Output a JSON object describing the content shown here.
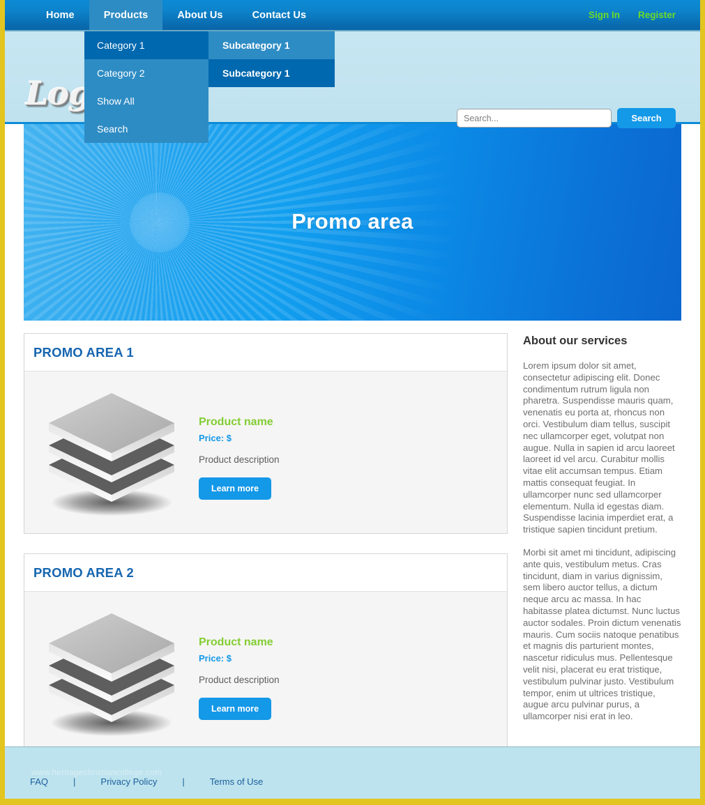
{
  "colors": {
    "page_border": "#e3c520",
    "nav_blue": "#0d84cc",
    "nav_active": "#2e8cc4",
    "dropdown_bg": "#2e8cc4",
    "dropdown_highlight": "#0068ae",
    "header_bg": "#c6e6f2",
    "auth_green": "#6ddb2a",
    "accent_blue": "#1498e8",
    "product_name_green": "#83cd34",
    "card_title_blue": "#1565b0",
    "footer_bg": "#bde3ee",
    "footer_link": "#1b5f9c"
  },
  "nav": {
    "items": [
      {
        "label": "Home",
        "active": false
      },
      {
        "label": "Products",
        "active": true
      },
      {
        "label": "About Us",
        "active": false
      },
      {
        "label": "Contact Us",
        "active": false
      }
    ],
    "sign_in": "Sign In",
    "register": "Register"
  },
  "dropdown": {
    "items": [
      {
        "label": "Category 1",
        "highlighted": true
      },
      {
        "label": "Category 2",
        "highlighted": false
      },
      {
        "label": "Show All",
        "highlighted": false
      },
      {
        "label": "Search",
        "highlighted": false
      }
    ]
  },
  "subdropdown": {
    "items": [
      {
        "label": "Subcategory 1",
        "style": "light"
      },
      {
        "label": "Subcategory 1",
        "style": "dark"
      }
    ]
  },
  "header": {
    "logo_text": "Logo"
  },
  "search": {
    "value": "",
    "placeholder": "Search...",
    "button_label": "Search"
  },
  "banner": {
    "title": "Promo area"
  },
  "promos": [
    {
      "title": "PROMO AREA 1",
      "product_name": "Product name",
      "price": "Price: $",
      "description": "Product description",
      "button_label": "Learn more",
      "image_name": "stacked-cubes-product-image"
    },
    {
      "title": "PROMO AREA 2",
      "product_name": "Product name",
      "price": "Price: $",
      "description": "Product description",
      "button_label": "Learn more",
      "image_name": "stacked-cubes-product-image"
    }
  ],
  "sidebar": {
    "title": "About our services",
    "paragraphs": [
      "Lorem ipsum dolor sit amet, consectetur adipiscing elit. Donec condimentum rutrum ligula non pharetra. Suspendisse mauris quam, venenatis eu porta at, rhoncus non orci. Vestibulum diam tellus, suscipit nec ullamcorper eget, volutpat non augue. Nulla in sapien id arcu laoreet laoreet id vel arcu. Curabitur mollis vitae elit accumsan tempus. Etiam mattis consequat feugiat. In ullamcorper nunc sed ullamcorper elementum. Nulla id egestas diam. Suspendisse lacinia imperdiet erat, a tristique sapien tincidunt pretium.",
      "Morbi sit amet mi tincidunt, adipiscing ante quis, vestibulum metus. Cras tincidunt, diam in varius dignissim, sem libero auctor tellus, a dictum neque arcu ac massa. In hac habitasse platea dictumst. Nunc luctus auctor sodales. Proin dictum venenatis mauris. Cum sociis natoque penatibus et magnis dis parturient montes, nascetur ridiculus mus. Pellentesque velit nisi, placerat eu erat tristique, vestibulum pulvinar justo. Vestibulum tempor, enim ut ultrices tristique, augue arcu pulvinar purus, a ullamcorper nisi erat in leo."
    ]
  },
  "footer": {
    "watermark": "www.heritagechristiancollege.com",
    "links": [
      {
        "label": "FAQ"
      },
      {
        "label": "Privacy Policy"
      },
      {
        "label": "Terms of Use"
      }
    ],
    "separator": "|"
  }
}
